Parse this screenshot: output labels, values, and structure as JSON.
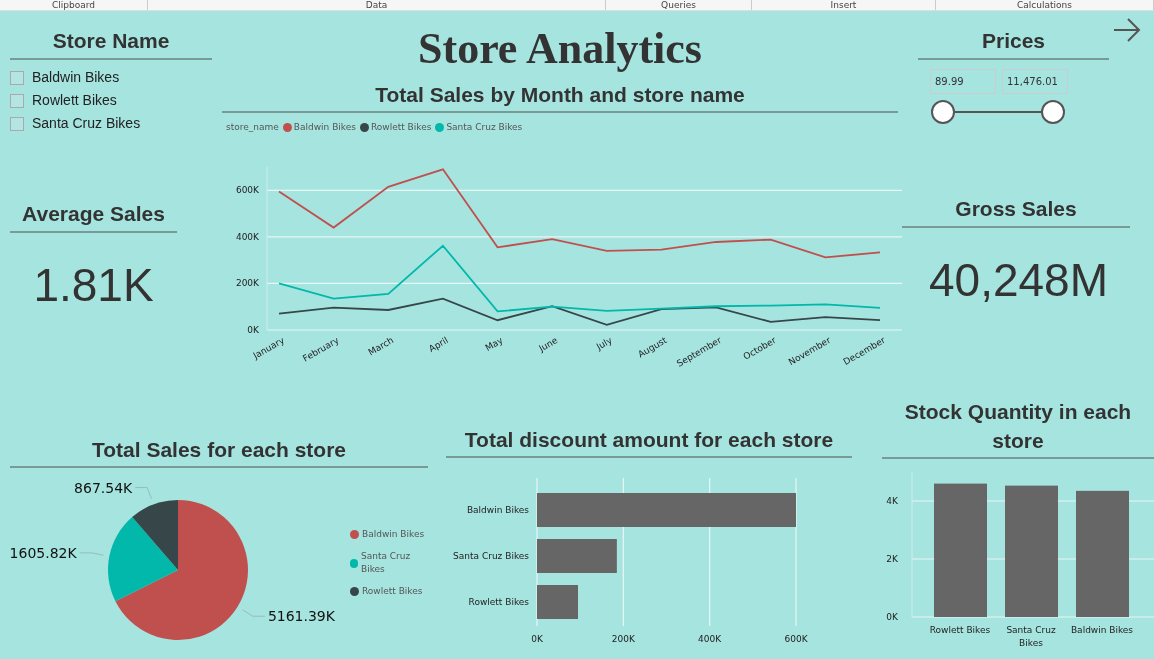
{
  "ribbon": [
    "Clipboard",
    "Data",
    "Queries",
    "Insert",
    "Calculations"
  ],
  "title": "Store Analytics",
  "store_slicer": {
    "title": "Store Name",
    "items": [
      {
        "label": "Baldwin Bikes",
        "checked": false
      },
      {
        "label": "Rowlett Bikes",
        "checked": false
      },
      {
        "label": "Santa Cruz Bikes",
        "checked": false
      }
    ]
  },
  "prices": {
    "title": "Prices",
    "min_value": "89.99",
    "max_value": "11,476.01",
    "thumbs": [
      {
        "level": 0
      },
      {
        "level": 1
      }
    ]
  },
  "average_sales": {
    "title": "Average Sales",
    "value": "1.81K"
  },
  "gross_sales": {
    "title": "Gross Sales",
    "value": "40,248M"
  },
  "line_panel": {
    "title": "Total Sales by Month and store name",
    "legend_title": "store_name",
    "chart_data": {
      "type": "line",
      "grid": true,
      "ylim": [
        0,
        700000
      ],
      "categories": [
        "January",
        "February",
        "March",
        "April",
        "May",
        "June",
        "July",
        "August",
        "September",
        "October",
        "November",
        "December"
      ],
      "yticks": [
        {
          "value": 0,
          "label": "0K"
        },
        {
          "value": 200000,
          "label": "200K"
        },
        {
          "value": 400000,
          "label": "400K"
        },
        {
          "value": 600000,
          "label": "600K"
        }
      ],
      "series": [
        {
          "name": "Baldwin Bikes",
          "color": "#c0504d",
          "values": [
            595000,
            440000,
            615000,
            690000,
            355000,
            390000,
            340000,
            345000,
            378000,
            388000,
            312000,
            333000
          ]
        },
        {
          "name": "Rowlett Bikes",
          "color": "#374649",
          "values": [
            70000,
            96000,
            86000,
            135000,
            42000,
            102000,
            22000,
            90000,
            97000,
            35000,
            55000,
            42000
          ]
        },
        {
          "name": "Santa Cruz Bikes",
          "color": "#01b8aa",
          "values": [
            200000,
            135000,
            155000,
            362000,
            80000,
            100000,
            82000,
            92000,
            102000,
            105000,
            110000,
            95000
          ]
        }
      ]
    }
  },
  "pie_panel": {
    "title": "Total Sales for each store",
    "chart_data": {
      "type": "pie",
      "categories": [
        "Baldwin Bikes",
        "Santa Cruz Bikes",
        "Rowlett Bikes"
      ],
      "values": [
        5161.39,
        1605.82,
        867.54
      ],
      "colors": [
        "#c0504d",
        "#01b8aa",
        "#374649"
      ],
      "value_labels": [
        "5161.39K",
        "1605.82K",
        "867.54K"
      ]
    }
  },
  "discount_panel": {
    "title": "Total discount amount for each store",
    "chart_data": {
      "type": "bar",
      "orientation": "horizontal",
      "grid": true,
      "categories": [
        "Baldwin Bikes",
        "Santa Cruz Bikes",
        "Rowlett Bikes"
      ],
      "values": [
        600000,
        185000,
        95000
      ],
      "xlim": [
        0,
        600000
      ],
      "xticks": [
        {
          "value": 0,
          "label": "0K"
        },
        {
          "value": 200000,
          "label": "200K"
        },
        {
          "value": 400000,
          "label": "400K"
        },
        {
          "value": 600000,
          "label": "600K"
        }
      ]
    }
  },
  "stock_panel": {
    "title": "Stock Quantity in each store",
    "chart_data": {
      "type": "bar",
      "orientation": "vertical",
      "grid": true,
      "categories": [
        "Rowlett Bikes",
        "Santa Cruz Bikes",
        "Baldwin Bikes"
      ],
      "values": [
        4600,
        4530,
        4350
      ],
      "ylim": [
        0,
        5000
      ],
      "yticks": [
        {
          "value": 0,
          "label": "0K"
        },
        {
          "value": 2000,
          "label": "2K"
        },
        {
          "value": 4000,
          "label": "4K"
        }
      ]
    }
  }
}
